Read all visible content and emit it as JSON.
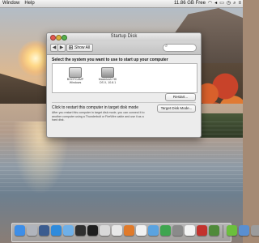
{
  "menubar": {
    "left_items": [
      "Window",
      "Help"
    ],
    "status": "11.86 GB Free",
    "icons": [
      "apple-icon",
      "wifi-icon",
      "volume-icon",
      "battery-icon",
      "clock-icon",
      "spotlight-icon",
      "notifications-icon"
    ]
  },
  "window": {
    "title": "Startup Disk",
    "show_all_label": "Show All",
    "nav_back": "◀",
    "nav_forward": "▶",
    "search_placeholder": "",
    "heading": "Select the system you want to use to start up your computer",
    "disks": [
      {
        "name": "BOOTCAMP",
        "system": "Windows",
        "selected": false
      },
      {
        "name": "Macintosh HD",
        "system": "OS X, 10.8.1",
        "selected": true
      }
    ],
    "restart_label": "Restart...",
    "target_mode_label": "Click to restart this computer in target disk mode",
    "target_mode_desc": "After you restart this computer in target disk mode, you can connect it to another computer using a Thunderbolt or FireWire cable and use it as a hard disk.",
    "target_mode_button": "Target Disk Mode..."
  },
  "dock": {
    "icons": [
      {
        "name": "finder",
        "color": "#3d8ee8"
      },
      {
        "name": "launchpad",
        "color": "#b0b4bc"
      },
      {
        "name": "mission-control",
        "color": "#3b5c8f"
      },
      {
        "name": "app-store",
        "color": "#2f8bdc"
      },
      {
        "name": "itunes",
        "color": "#6fb0e8"
      },
      {
        "name": "activity-monitor",
        "color": "#2f2f2f"
      },
      {
        "name": "terminal",
        "color": "#1e1e1e"
      },
      {
        "name": "preview",
        "color": "#d9d9d9"
      },
      {
        "name": "chrome",
        "color": "#e8e8e8"
      },
      {
        "name": "firefox",
        "color": "#e07a2a"
      },
      {
        "name": "textedit",
        "color": "#f2f2f2"
      },
      {
        "name": "safari",
        "color": "#5aa3e0"
      },
      {
        "name": "messages",
        "color": "#3ea54f"
      },
      {
        "name": "system-preferences",
        "color": "#8a8a8a"
      },
      {
        "name": "calendar",
        "color": "#f4f4f4"
      },
      {
        "name": "photo-booth",
        "color": "#c2322d"
      },
      {
        "name": "dictionary",
        "color": "#4f8a3a"
      },
      {
        "name": "spotify",
        "color": "#6bbf3d"
      },
      {
        "name": "downloads",
        "color": "#5a8fd0"
      },
      {
        "name": "trash",
        "color": "#9c9c9c"
      }
    ]
  }
}
